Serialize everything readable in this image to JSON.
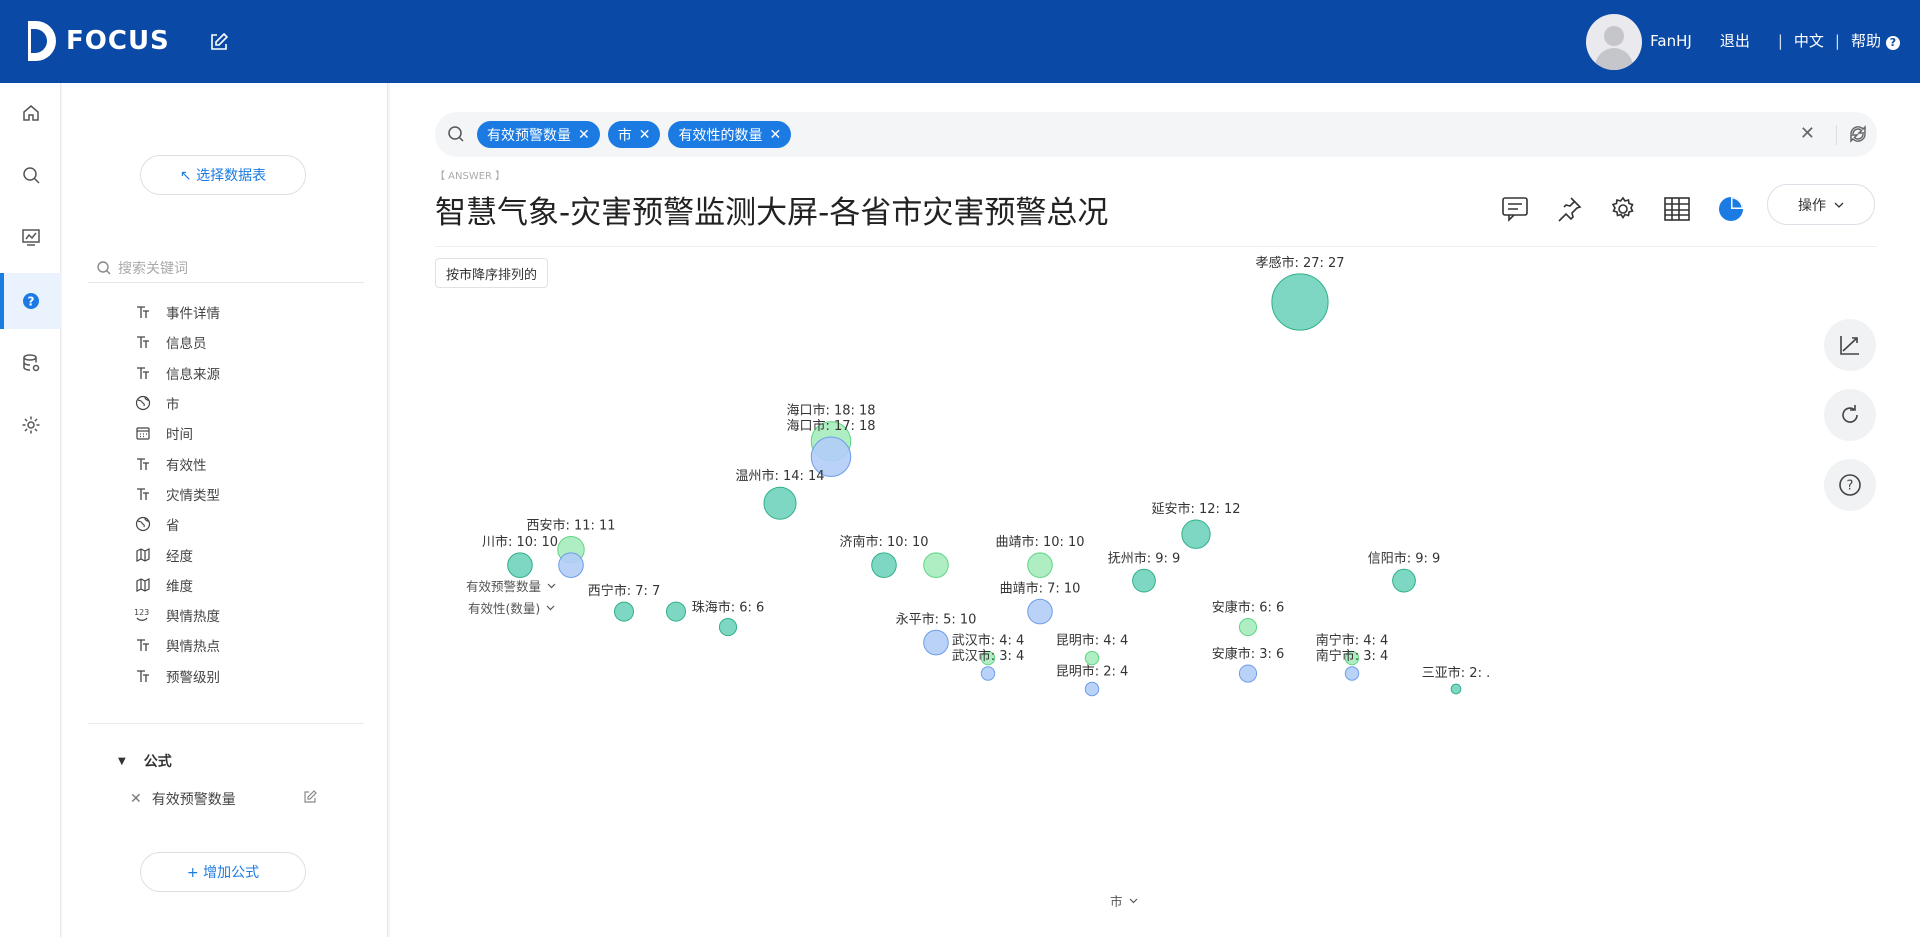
{
  "app": {
    "logo_text": "FOCUS"
  },
  "topbar": {
    "user": "FanHJ",
    "logout": "退出",
    "language": "中文",
    "help": "帮助",
    "separator": "|"
  },
  "rail": {
    "items": [
      "home-icon",
      "search-icon",
      "dashboard-icon",
      "question-icon",
      "database-icon",
      "settings-icon"
    ],
    "active": "question-icon"
  },
  "panel": {
    "select_table": "↖ 选择数据表",
    "search_placeholder": "搜索关键词",
    "fields": [
      {
        "label": "事件详情",
        "type": "text"
      },
      {
        "label": "信息员",
        "type": "text"
      },
      {
        "label": "信息来源",
        "type": "text"
      },
      {
        "label": "市",
        "type": "geo"
      },
      {
        "label": "时间",
        "type": "date"
      },
      {
        "label": "有效性",
        "type": "text"
      },
      {
        "label": "灾情类型",
        "type": "text"
      },
      {
        "label": "省",
        "type": "geo"
      },
      {
        "label": "经度",
        "type": "geo-map"
      },
      {
        "label": "维度",
        "type": "geo-map"
      },
      {
        "label": "舆情热度",
        "type": "number"
      },
      {
        "label": "舆情热点",
        "type": "text"
      },
      {
        "label": "预警级别",
        "type": "text"
      }
    ],
    "formula_header": "公式",
    "formula_items": [
      "有效预警数量"
    ],
    "add_formula": "+ 增加公式"
  },
  "search": {
    "tags": [
      "有效预警数量",
      "市",
      "有效性的数量"
    ]
  },
  "answer": {
    "tag": "【 ANSWER 】",
    "title": "智慧气象-灾害预警监测大屏-各省市灾害预警总况",
    "ops_button": "操作",
    "sort_label": "按市降序排列的"
  },
  "toolbar_icons": [
    "comment-icon",
    "pin-icon",
    "gear-icon",
    "table-icon",
    "pie-chart-icon"
  ],
  "side_buttons": [
    "axis-icon",
    "rotate-icon",
    "help-circle-icon"
  ],
  "colors": {
    "brand": "#0a49a6",
    "accent": "#1b7be3",
    "series1": "#4cc5a4",
    "series2": "#8fb6f5",
    "series3": "#90e6aa"
  },
  "chart_data": {
    "type": "scatter",
    "xlabel": "市",
    "y_selectors": [
      "有效预警数量",
      "有效性(数量)"
    ],
    "points": [
      {
        "label": "孝感市: 27: 27",
        "series": "teal",
        "y": 27,
        "size": 27
      },
      {
        "label": "海口市: 18: 18",
        "series": "green",
        "y": 18,
        "size": 18
      },
      {
        "label": "海口市: 17: 18",
        "series": "blue",
        "y": 17,
        "size": 18
      },
      {
        "label": "温州市: 14: 14",
        "series": "teal",
        "y": 14,
        "size": 14
      },
      {
        "label": "延安市: 12: 12",
        "series": "teal",
        "y": 12,
        "size": 12
      },
      {
        "label": "西安市: 11: 11",
        "series": "green",
        "y": 11,
        "size": 11
      },
      {
        "label": "川市: 10: 10",
        "series": "teal",
        "y": 10,
        "size": 10
      },
      {
        "label": "",
        "series": "blue",
        "y": 10,
        "size": 10
      },
      {
        "label": "济南市: 10: 10",
        "series": "teal",
        "y": 10,
        "size": 10
      },
      {
        "label": "",
        "series": "green",
        "y": 10,
        "size": 10
      },
      {
        "label": "曲靖市: 10: 10",
        "series": "green",
        "y": 10,
        "size": 10
      },
      {
        "label": "抚州市: 9: 9",
        "series": "teal",
        "y": 9,
        "size": 9
      },
      {
        "label": "信阳市: 9: 9",
        "series": "teal",
        "y": 9,
        "size": 9
      },
      {
        "label": "西宁市: 7: 7",
        "series": "teal",
        "y": 7,
        "size": 7
      },
      {
        "label": "",
        "series": "teal",
        "y": 7,
        "size": 7
      },
      {
        "label": "曲靖市: 7: 10",
        "series": "blue",
        "y": 7,
        "size": 10
      },
      {
        "label": "珠海市: 6: 6",
        "series": "teal",
        "y": 6,
        "size": 6
      },
      {
        "label": "安康市: 6: 6",
        "series": "green",
        "y": 6,
        "size": 6
      },
      {
        "label": "永平市: 5: 10",
        "series": "blue",
        "y": 5,
        "size": 10
      },
      {
        "label": "武汉市: 4: 4",
        "series": "green",
        "y": 4,
        "size": 4
      },
      {
        "label": "昆明市: 4: 4",
        "series": "green",
        "y": 4,
        "size": 4
      },
      {
        "label": "南宁市: 4: 4",
        "series": "green",
        "y": 4,
        "size": 4
      },
      {
        "label": "武汉市: 3: 4",
        "series": "blue",
        "y": 3,
        "size": 4
      },
      {
        "label": "安康市: 3: 6",
        "series": "blue",
        "y": 3,
        "size": 6
      },
      {
        "label": "南宁市: 3: 4",
        "series": "blue",
        "y": 3,
        "size": 4
      },
      {
        "label": "昆明市: 2: 4",
        "series": "blue",
        "y": 2,
        "size": 4
      },
      {
        "label": "三亚市: 2: .",
        "series": "teal",
        "y": 2,
        "size": 2
      }
    ]
  }
}
